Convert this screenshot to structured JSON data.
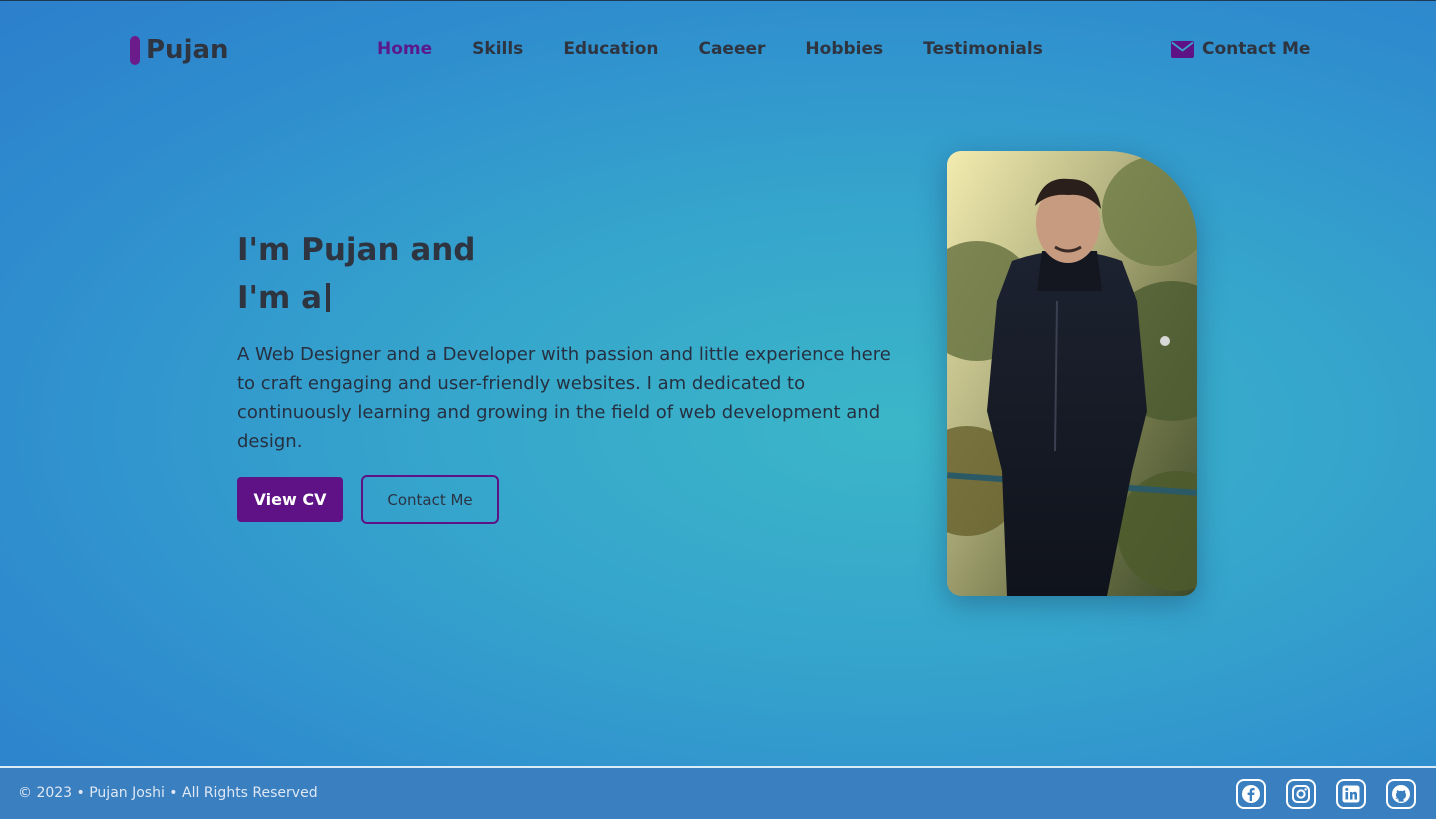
{
  "header": {
    "logo": "Pujan",
    "nav": [
      "Home",
      "Skills",
      "Education",
      "Caeeer",
      "Hobbies",
      "Testimonials"
    ],
    "active_nav": "Home",
    "contact_label": "Contact Me"
  },
  "hero": {
    "line1": "I'm Pujan and",
    "line2": "I'm a",
    "description": "A Web Designer and a Developer with passion and little experience here to craft engaging and user-friendly websites. I am dedicated to continuously learning and growing in the field of web development and design.",
    "cv_button": "View CV",
    "contact_button": "Contact Me"
  },
  "footer": {
    "copyright": "© 2023 • Pujan Joshi • All Rights Reserved",
    "socials": [
      "facebook-icon",
      "instagram-icon",
      "linkedin-icon",
      "github-icon"
    ]
  },
  "colors": {
    "accent": "#5e1285",
    "active_nav": "#5b1a8c",
    "text": "#2e3440",
    "footer_bg": "#3a7fc0"
  }
}
